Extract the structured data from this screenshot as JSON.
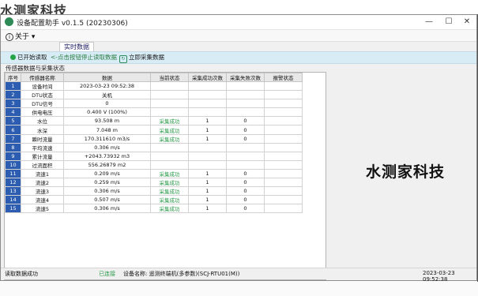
{
  "watermark_top": "水测家科技",
  "window": {
    "title": "设备配置助手 v0.1.5 (20230306)",
    "controls": {
      "minimize": "—",
      "maximize": "☐",
      "close": "✕"
    }
  },
  "menu": {
    "about": "关于",
    "about_icon": "i"
  },
  "tab": {
    "label": "实时数据"
  },
  "toolbar": {
    "start_read": "已开始读取",
    "hint": "<-点击按钮停止读取数据",
    "collect_now": "立即采集数据"
  },
  "section_label": "传感器数据与采集状态",
  "table": {
    "headers": [
      "序号",
      "传感器名称",
      "数据",
      "当前状态",
      "采集成功次数",
      "采集失败次数",
      "报警状态"
    ],
    "rows": [
      [
        "1",
        "设备时间",
        "2023-03-23 09:52:38",
        "",
        "",
        "",
        ""
      ],
      [
        "2",
        "DTU状态",
        "关机",
        "",
        "",
        "",
        ""
      ],
      [
        "3",
        "DTU信号",
        "0",
        "",
        "",
        "",
        ""
      ],
      [
        "4",
        "供电电压",
        "0.400 V (100%)",
        "",
        "",
        "",
        ""
      ],
      [
        "5",
        "水位",
        "93.508 m",
        "采集成功",
        "1",
        "0",
        ""
      ],
      [
        "6",
        "水深",
        "7.048 m",
        "采集成功",
        "1",
        "0",
        ""
      ],
      [
        "7",
        "瞬时流量",
        "170.311610 m3/s",
        "采集成功",
        "1",
        "0",
        ""
      ],
      [
        "8",
        "平均流速",
        "0.306 m/s",
        "",
        "",
        "",
        ""
      ],
      [
        "9",
        "累计流量",
        "+2043.73932 m3",
        "",
        "",
        "",
        ""
      ],
      [
        "10",
        "过流面积",
        "556.26879 m2",
        "",
        "",
        "",
        ""
      ],
      [
        "11",
        "流速1",
        "0.209 m/s",
        "采集成功",
        "1",
        "0",
        ""
      ],
      [
        "12",
        "流速2",
        "0.259 m/s",
        "采集成功",
        "1",
        "0",
        ""
      ],
      [
        "13",
        "流速3",
        "0.306 m/s",
        "采集成功",
        "1",
        "0",
        ""
      ],
      [
        "14",
        "流速4",
        "0.507 m/s",
        "采集成功",
        "1",
        "0",
        ""
      ],
      [
        "15",
        "流速5",
        "0.306 m/s",
        "采集成功",
        "1",
        "0",
        ""
      ]
    ]
  },
  "side_text": "水测家科技",
  "status": {
    "left": "读取数据成功",
    "connected": "已连接",
    "device": "设备名称: 遥测终端机(多参数)(SCJ-RTU01(M))",
    "time": "2023-03-23 09:52:38"
  }
}
